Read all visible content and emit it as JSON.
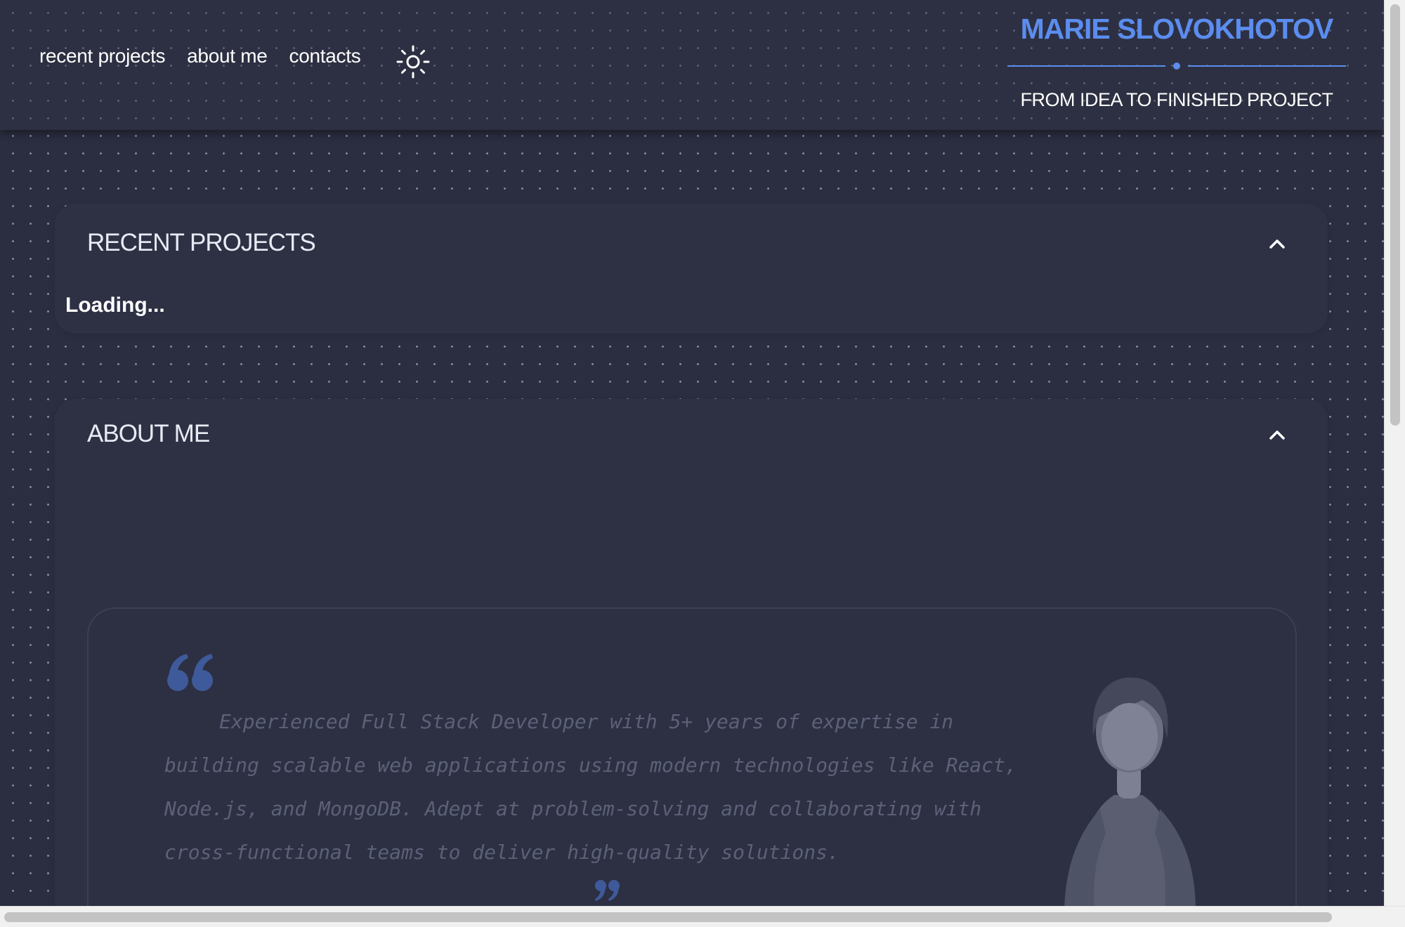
{
  "header": {
    "nav": [
      "recent projects",
      "about me",
      "contacts"
    ],
    "theme_icon": "sun-icon",
    "brand_name": "MARIE SLOVOKHOTOV",
    "tagline": "FROM IDEA TO FINISHED PROJECT"
  },
  "sections": {
    "projects": {
      "title": "RECENT PROJECTS",
      "status": "Loading...",
      "toggle_icon": "chevron-up-icon"
    },
    "about": {
      "title": "ABOUT ME",
      "toggle_icon": "chevron-up-icon",
      "quote": "Experienced Full Stack Developer with 5+ years of expertise in building scalable web applications using modern technologies like React, Node.js, and MongoDB. Adept at problem-solving and collaborating with cross-functional teams to deliver high-quality solutions."
    }
  },
  "colors": {
    "accent": "#5b8def",
    "background": "#2b2e40",
    "text": "#ffffff",
    "muted_text": "#5c6178"
  }
}
